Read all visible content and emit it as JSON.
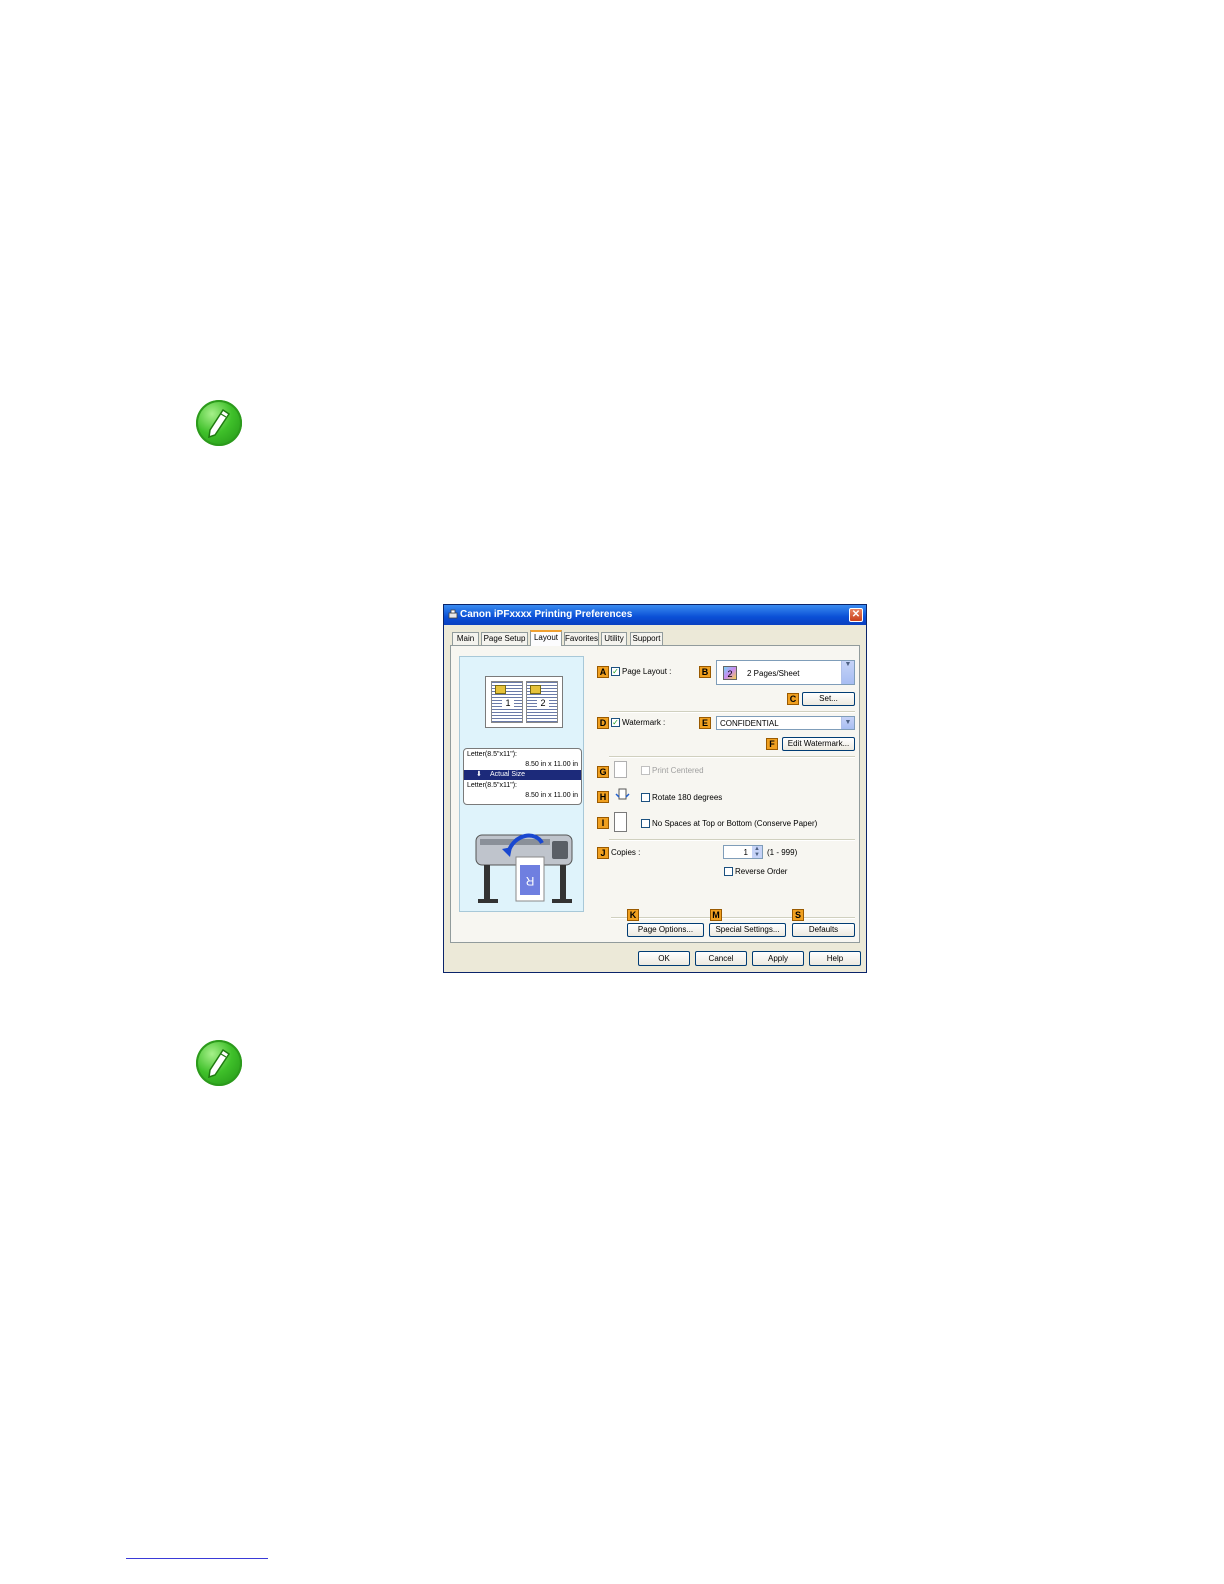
{
  "dialog": {
    "title": "Canon iPFxxxx Printing Preferences",
    "close_glyph": "✕",
    "tabs": [
      "Main",
      "Page Setup",
      "Layout",
      "Favorites",
      "Utility",
      "Support"
    ],
    "active_tab": "Layout",
    "preview": {
      "page_numbers": [
        "1",
        "2"
      ],
      "source_size": "Letter(8.5\"x11\"):",
      "source_dims": "8.50 in x 11.00 in",
      "scale_label": "Actual Size",
      "scale_arrow": "⬇",
      "output_size": "Letter(8.5\"x11\"):",
      "output_dims": "8.50 in x 11.00 in",
      "printer_page_letter": "R"
    },
    "markers": {
      "A": "A",
      "B": "B",
      "C": "C",
      "D": "D",
      "E": "E",
      "F": "F",
      "G": "G",
      "H": "H",
      "I": "I",
      "J": "J",
      "K": "K",
      "M": "M",
      "S": "S"
    },
    "page_layout": {
      "label": "Page Layout :",
      "checked": true,
      "check_glyph": "✓",
      "value": "2 Pages/Sheet",
      "icon_text": "2"
    },
    "set_button": "Set...",
    "watermark": {
      "label": "Watermark :",
      "checked": true,
      "check_glyph": "✓",
      "value": "CONFIDENTIAL"
    },
    "edit_watermark_button": "Edit Watermark...",
    "print_centered": {
      "label": "Print Centered",
      "checked": false,
      "enabled": false
    },
    "rotate": {
      "label": "Rotate 180 degrees",
      "checked": false
    },
    "no_spaces": {
      "label": "No Spaces at Top or Bottom (Conserve Paper)",
      "checked": false
    },
    "copies": {
      "label": "Copies :",
      "value": "1",
      "range": "(1 - 999)"
    },
    "reverse_order": {
      "label": "Reverse Order",
      "checked": false
    },
    "bottom_buttons": {
      "page_options": "Page Options...",
      "special_settings": "Special Settings...",
      "defaults": "Defaults"
    },
    "footer_buttons": {
      "ok": "OK",
      "cancel": "Cancel",
      "apply": "Apply",
      "help": "Help"
    },
    "colors": {
      "marker": "#f0a020",
      "titlebar": "#0a4fd6",
      "preview_bg": "#dff3fb",
      "note_icon": "#3fc02a"
    }
  }
}
